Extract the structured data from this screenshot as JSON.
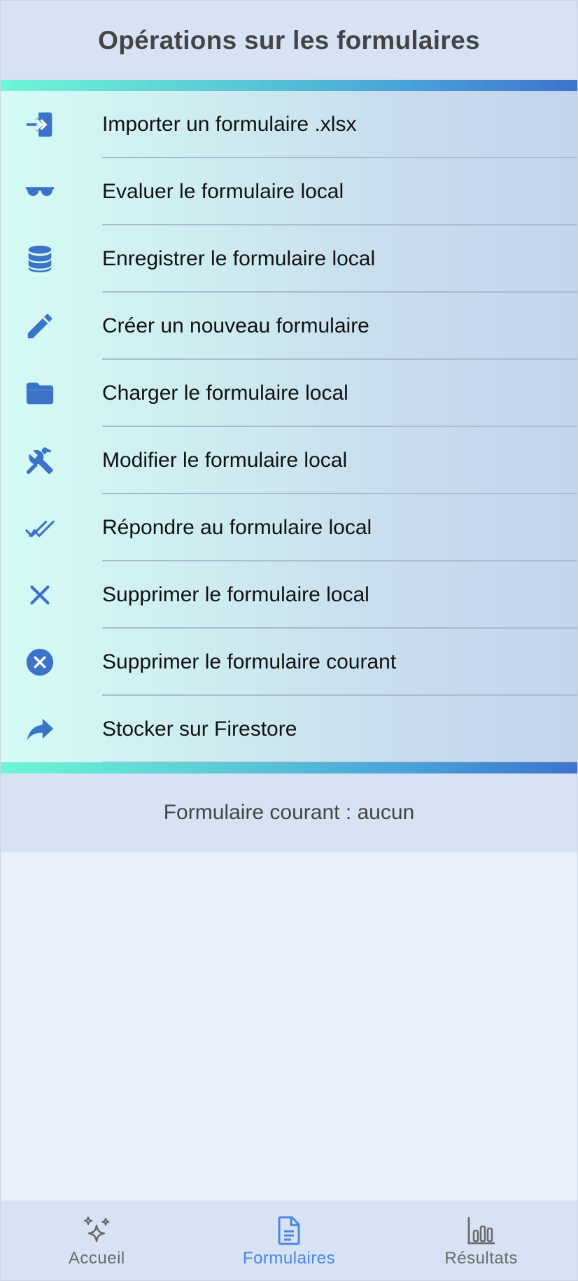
{
  "header": {
    "title": "Opérations sur les formulaires"
  },
  "menu": {
    "items": [
      {
        "label": "Importer un formulaire .xlsx",
        "icon": "login-icon"
      },
      {
        "label": "Evaluer le formulaire local",
        "icon": "sunglasses-icon"
      },
      {
        "label": "Enregistrer le formulaire local",
        "icon": "database-icon"
      },
      {
        "label": "Créer un nouveau formulaire",
        "icon": "pencil-icon"
      },
      {
        "label": "Charger le formulaire local",
        "icon": "folder-icon"
      },
      {
        "label": "Modifier le formulaire local",
        "icon": "tools-icon"
      },
      {
        "label": "Répondre au formulaire local",
        "icon": "double-check-icon"
      },
      {
        "label": "Supprimer le formulaire local",
        "icon": "close-icon"
      },
      {
        "label": "Supprimer le formulaire courant",
        "icon": "cancel-circle-icon"
      },
      {
        "label": "Stocker sur Firestore",
        "icon": "share-arrow-icon"
      }
    ]
  },
  "status": {
    "current_form": "Formulaire courant : aucun"
  },
  "bottom_nav": {
    "items": [
      {
        "label": "Accueil",
        "icon": "sparkles-icon",
        "active": false
      },
      {
        "label": "Formulaires",
        "icon": "document-icon",
        "active": true
      },
      {
        "label": "Résultats",
        "icon": "bar-chart-icon",
        "active": false
      }
    ]
  },
  "colors": {
    "accent": "#3b73c8",
    "active_nav": "#4d84e6",
    "header_bg": "#d7e3f4",
    "page_bg": "#e9f0fa"
  }
}
